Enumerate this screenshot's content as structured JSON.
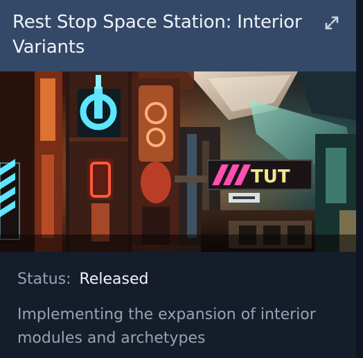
{
  "card": {
    "title": "Rest Stop Space Station: Interior Variants",
    "expand_icon": "external-expand-icon",
    "image": "space-station-interior-render",
    "image_sign_text": "TUT",
    "status_label": "Status:",
    "status_value": "Released",
    "description": "Implementing the expansion of interior modules and archetypes"
  },
  "colors": {
    "header_bg": "#344967",
    "card_bg": "#151d2b",
    "title": "#eef3fa",
    "label": "#97a3b3",
    "value": "#f2f5f9",
    "neon_cyan": "#5fe6ff",
    "neon_magenta": "#ff4fb2",
    "warm_orange": "#ff8a3d"
  }
}
